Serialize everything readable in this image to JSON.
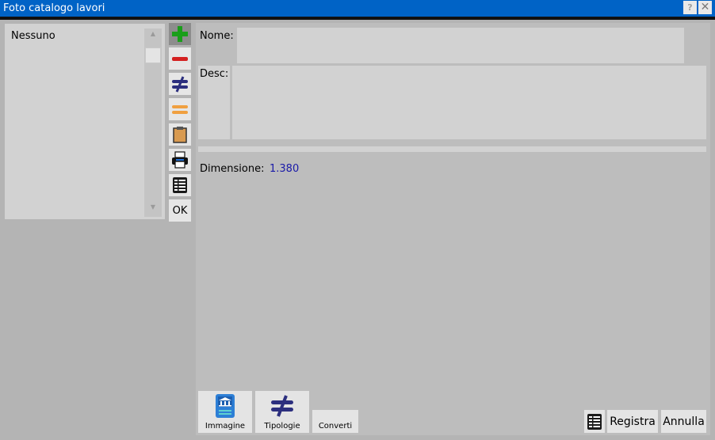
{
  "window": {
    "title": "Foto catalogo lavori",
    "help_label": "?",
    "close_label": "✕"
  },
  "list": {
    "items": [
      "Nessuno"
    ]
  },
  "toolbar": {
    "icons": [
      "add-icon",
      "remove-icon",
      "not-equal-icon",
      "equal-icon",
      "clipboard-icon",
      "printer-icon",
      "spreadsheet-icon"
    ],
    "ok_label": "OK"
  },
  "form": {
    "nome_label": "Nome:",
    "nome_value": "",
    "desc_label": "Desc:",
    "desc_value": "",
    "dimensione_label": "Dimensione:",
    "dimensione_value": "1.380"
  },
  "tabs": [
    {
      "label": "Immagine",
      "icon": "book-bank-icon"
    },
    {
      "label": "Tipologie",
      "icon": "not-equal-icon"
    },
    {
      "label": "Converti",
      "icon": ""
    }
  ],
  "actions": {
    "registra_label": "Registra",
    "annulla_label": "Annulla"
  },
  "colors": {
    "titlebar": "#0063c6",
    "accent_green": "#1a9e1a",
    "accent_red": "#d42020",
    "accent_orange": "#f0a040",
    "accent_navy": "#2c2f7e"
  }
}
